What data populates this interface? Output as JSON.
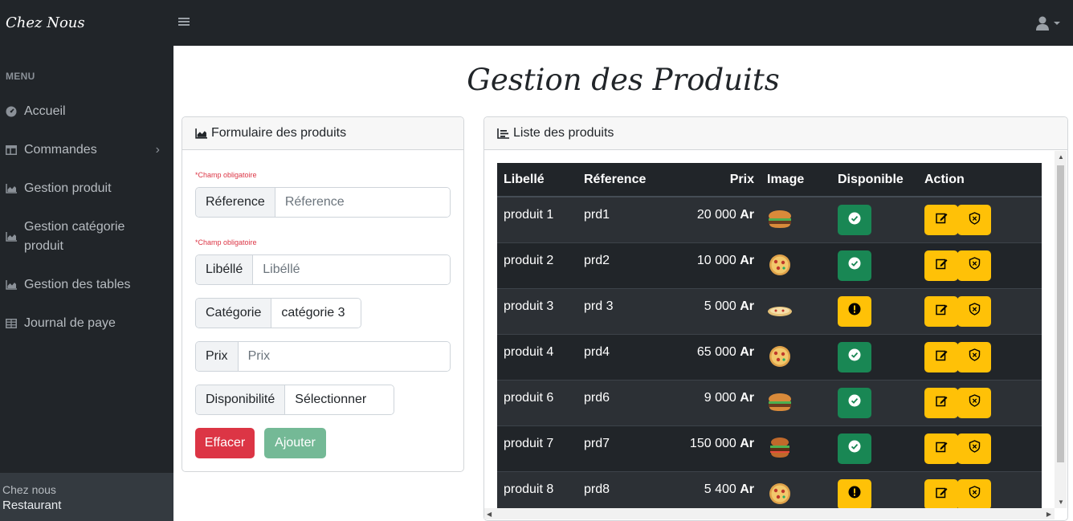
{
  "brand": "Chez Nous",
  "sidebar": {
    "heading": "MENU",
    "items": [
      {
        "label": "Accueil",
        "icon": "dashboard-icon"
      },
      {
        "label": "Commandes",
        "icon": "columns-icon",
        "has_submenu": true
      },
      {
        "label": "Gestion produit",
        "icon": "chart-area-icon"
      },
      {
        "label": "Gestion catégorie produit",
        "icon": "chart-area-icon"
      },
      {
        "label": "Gestion des tables",
        "icon": "chart-area-icon"
      },
      {
        "label": "Journal de paye",
        "icon": "table-icon"
      }
    ],
    "footer": {
      "line1": "Chez nous",
      "line2": "Restaurant"
    }
  },
  "page_title": "Gestion des Produits",
  "form": {
    "title": "Formulaire des produits",
    "required_note": "*Champ obligatoire",
    "reference": {
      "label": "Réference",
      "placeholder": "Réference"
    },
    "libelle": {
      "label": "Libéllé",
      "placeholder": "Libéllé"
    },
    "categorie": {
      "label": "Catégorie",
      "value": "catégorie 3"
    },
    "prix": {
      "label": "Prix",
      "placeholder": "Prix"
    },
    "disponibilite": {
      "label": "Disponibilité",
      "value": "Sélectionner"
    },
    "clear_label": "Effacer",
    "add_label": "Ajouter"
  },
  "list": {
    "title": "Liste des produits",
    "columns": [
      "Libellé",
      "Réference",
      "Prix",
      "Image",
      "Disponible",
      "Action"
    ],
    "currency": "Ar",
    "rows": [
      {
        "libelle": "produit 1",
        "reference": "prd1",
        "prix": "20 000",
        "image": "burger",
        "disponible": true
      },
      {
        "libelle": "produit 2",
        "reference": "prd2",
        "prix": "10 000",
        "image": "pizza",
        "disponible": true
      },
      {
        "libelle": "produit 3",
        "reference": "prd 3",
        "prix": "5 000",
        "image": "flat-pizza",
        "disponible": false
      },
      {
        "libelle": "produit 4",
        "reference": "prd4",
        "prix": "65 000",
        "image": "pizza",
        "disponible": true
      },
      {
        "libelle": "produit 6",
        "reference": "prd6",
        "prix": "9 000",
        "image": "burger",
        "disponible": true
      },
      {
        "libelle": "produit 7",
        "reference": "prd7",
        "prix": "150 000",
        "image": "big-burger",
        "disponible": true
      },
      {
        "libelle": "produit 8",
        "reference": "prd8",
        "prix": "5 400",
        "image": "pizza",
        "disponible": false
      }
    ]
  },
  "colors": {
    "dark": "#212529",
    "success": "#198754",
    "warning": "#ffc107",
    "danger": "#dc3545",
    "success_light": "#74b996"
  }
}
